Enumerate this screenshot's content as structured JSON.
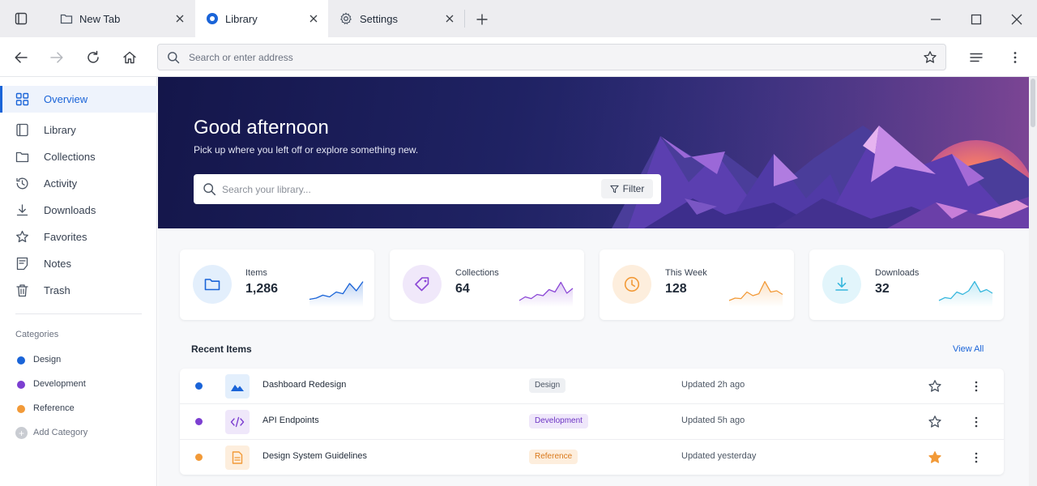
{
  "tabs": [
    {
      "label": "New Tab",
      "icon": "folder-icon",
      "active": false
    },
    {
      "label": "Library",
      "icon": "library-dot-icon",
      "active": true
    },
    {
      "label": "Settings",
      "icon": "gear-icon",
      "active": false
    }
  ],
  "toolbar": {
    "address_placeholder": "Search or enter address"
  },
  "sidebar": {
    "items": [
      {
        "label": "Overview",
        "icon": "grid-icon",
        "active": true
      },
      {
        "label": "Library",
        "icon": "book-icon",
        "active": false
      },
      {
        "label": "Collections",
        "icon": "folder-icon",
        "active": false
      },
      {
        "label": "Activity",
        "icon": "history-icon",
        "active": false
      },
      {
        "label": "Downloads",
        "icon": "download-icon",
        "active": false
      },
      {
        "label": "Favorites",
        "icon": "star-icon",
        "active": false
      },
      {
        "label": "Notes",
        "icon": "note-icon",
        "active": false
      },
      {
        "label": "Trash",
        "icon": "trash-icon",
        "active": false
      }
    ],
    "categories_heading": "Categories",
    "categories": [
      {
        "label": "Design",
        "color": "#1a64d8"
      },
      {
        "label": "Development",
        "color": "#7c3fd1"
      },
      {
        "label": "Reference",
        "color": "#f29a38"
      }
    ],
    "add_category": "Add Category"
  },
  "hero": {
    "title": "Good afternoon",
    "subtitle": "Pick up where you left off or explore something new.",
    "search_placeholder": "Search your library...",
    "filter_label": "Filter"
  },
  "stats": [
    {
      "label": "Items",
      "value": "1,286",
      "icon": "folder-icon",
      "color": "#1a64d8",
      "bg": "#e3effc",
      "spark": [
        0.25,
        0.3,
        0.42,
        0.35,
        0.55,
        0.48,
        0.9,
        0.6,
        0.98
      ]
    },
    {
      "label": "Collections",
      "value": "64",
      "icon": "tag-icon",
      "color": "#8b47d6",
      "bg": "#f0e8fa",
      "spark": [
        0.2,
        0.35,
        0.28,
        0.45,
        0.4,
        0.65,
        0.55,
        0.95,
        0.5,
        0.7
      ]
    },
    {
      "label": "This Week",
      "value": "128",
      "icon": "clock-icon",
      "color": "#f29a38",
      "bg": "#fdeedd",
      "spark": [
        0.2,
        0.3,
        0.28,
        0.55,
        0.4,
        0.48,
        0.98,
        0.55,
        0.6,
        0.45
      ]
    },
    {
      "label": "Downloads",
      "value": "32",
      "icon": "download-icon",
      "color": "#36b7dd",
      "bg": "#e2f5fb",
      "spark": [
        0.2,
        0.32,
        0.28,
        0.55,
        0.45,
        0.6,
        0.98,
        0.55,
        0.65,
        0.5
      ]
    }
  ],
  "recent": {
    "title": "Recent Items",
    "view_all": "View All",
    "items": [
      {
        "title": "Dashboard Redesign",
        "tag": "Design",
        "updated": "Updated 2h ago",
        "starred": false,
        "dot": "#1a64d8",
        "thumb_icon": "image-icon",
        "thumb_color": "#1a64d8",
        "thumb_bg": "#e3effc",
        "tag_color": "#4b5563",
        "tag_bg": "#eef0f3"
      },
      {
        "title": "API Endpoints",
        "tag": "Development",
        "updated": "Updated 5h ago",
        "starred": false,
        "dot": "#7c3fd1",
        "thumb_icon": "code-icon",
        "thumb_color": "#7c3fd1",
        "thumb_bg": "#efe7fa",
        "tag_color": "#6d35c4",
        "tag_bg": "#efe7fa"
      },
      {
        "title": "Design System Guidelines",
        "tag": "Reference",
        "updated": "Updated yesterday",
        "starred": true,
        "dot": "#f29a38",
        "thumb_icon": "document-icon",
        "thumb_color": "#f29a38",
        "thumb_bg": "#fdeedd",
        "tag_color": "#d9781a",
        "tag_bg": "#fdeedd"
      }
    ]
  }
}
